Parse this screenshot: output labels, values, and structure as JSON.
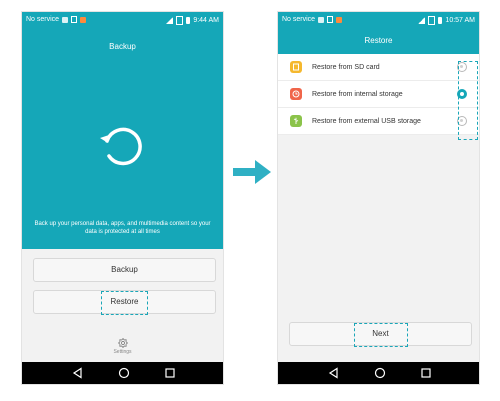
{
  "phone1": {
    "status": {
      "carrier": "No service",
      "time": "9:44 AM"
    },
    "title": "Backup",
    "description": "Back up your personal data, apps, and multimedia content so your data is protected at all times",
    "backup_button": "Backup",
    "restore_button": "Restore",
    "settings_label": "Settings"
  },
  "phone2": {
    "status": {
      "carrier": "No service",
      "time": "10:57 AM"
    },
    "title": "Restore",
    "options": [
      {
        "label": "Restore from SD card",
        "icon": "sd-card-icon",
        "color": "#f5b82e",
        "selected": false
      },
      {
        "label": "Restore from internal storage",
        "icon": "clock-icon",
        "color": "#f0654a",
        "selected": true
      },
      {
        "label": "Restore from external USB storage",
        "icon": "usb-icon",
        "color": "#8bc34a",
        "selected": false
      }
    ],
    "next_button": "Next"
  },
  "colors": {
    "accent": "#15a7b8",
    "highlight": "#1aa6b8",
    "arrow": "#2fb0c4"
  }
}
